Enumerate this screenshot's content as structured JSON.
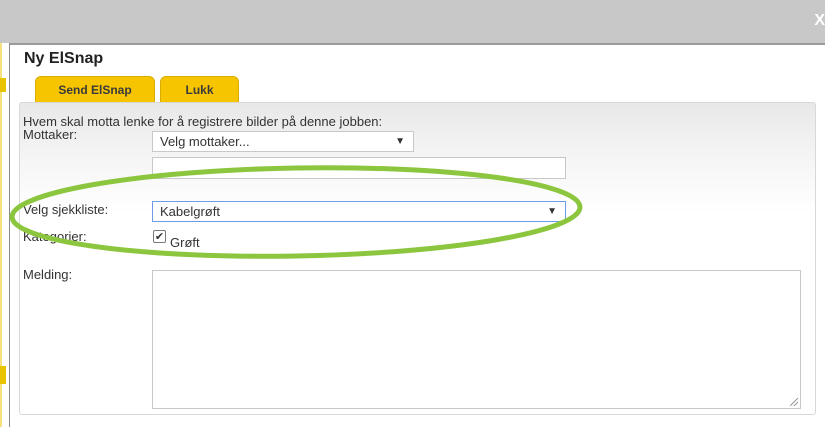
{
  "window": {
    "close_label": "X"
  },
  "dialog": {
    "title": "Ny ElSnap"
  },
  "tabs": [
    {
      "label": "Send ElSnap"
    },
    {
      "label": "Lukk"
    }
  ],
  "form": {
    "intro": "Hvem skal motta lenke for å registrere bilder på denne jobben:",
    "recipient": {
      "label": "Mottaker:",
      "selected": "Velg mottaker...",
      "text_value": ""
    },
    "checklist": {
      "label": "Velg sjekkliste:",
      "selected": "Kabelgrøft"
    },
    "categories": {
      "label": "Kategorier:",
      "items": [
        {
          "label": "Grøft",
          "checked": true
        }
      ]
    },
    "message": {
      "label": "Melding:",
      "value": ""
    }
  },
  "annotation": {
    "color": "#8cc63f"
  },
  "colors": {
    "tab": "#f7c400",
    "focus_border": "#6d9be8",
    "titlebar": "#c8c8c8"
  }
}
